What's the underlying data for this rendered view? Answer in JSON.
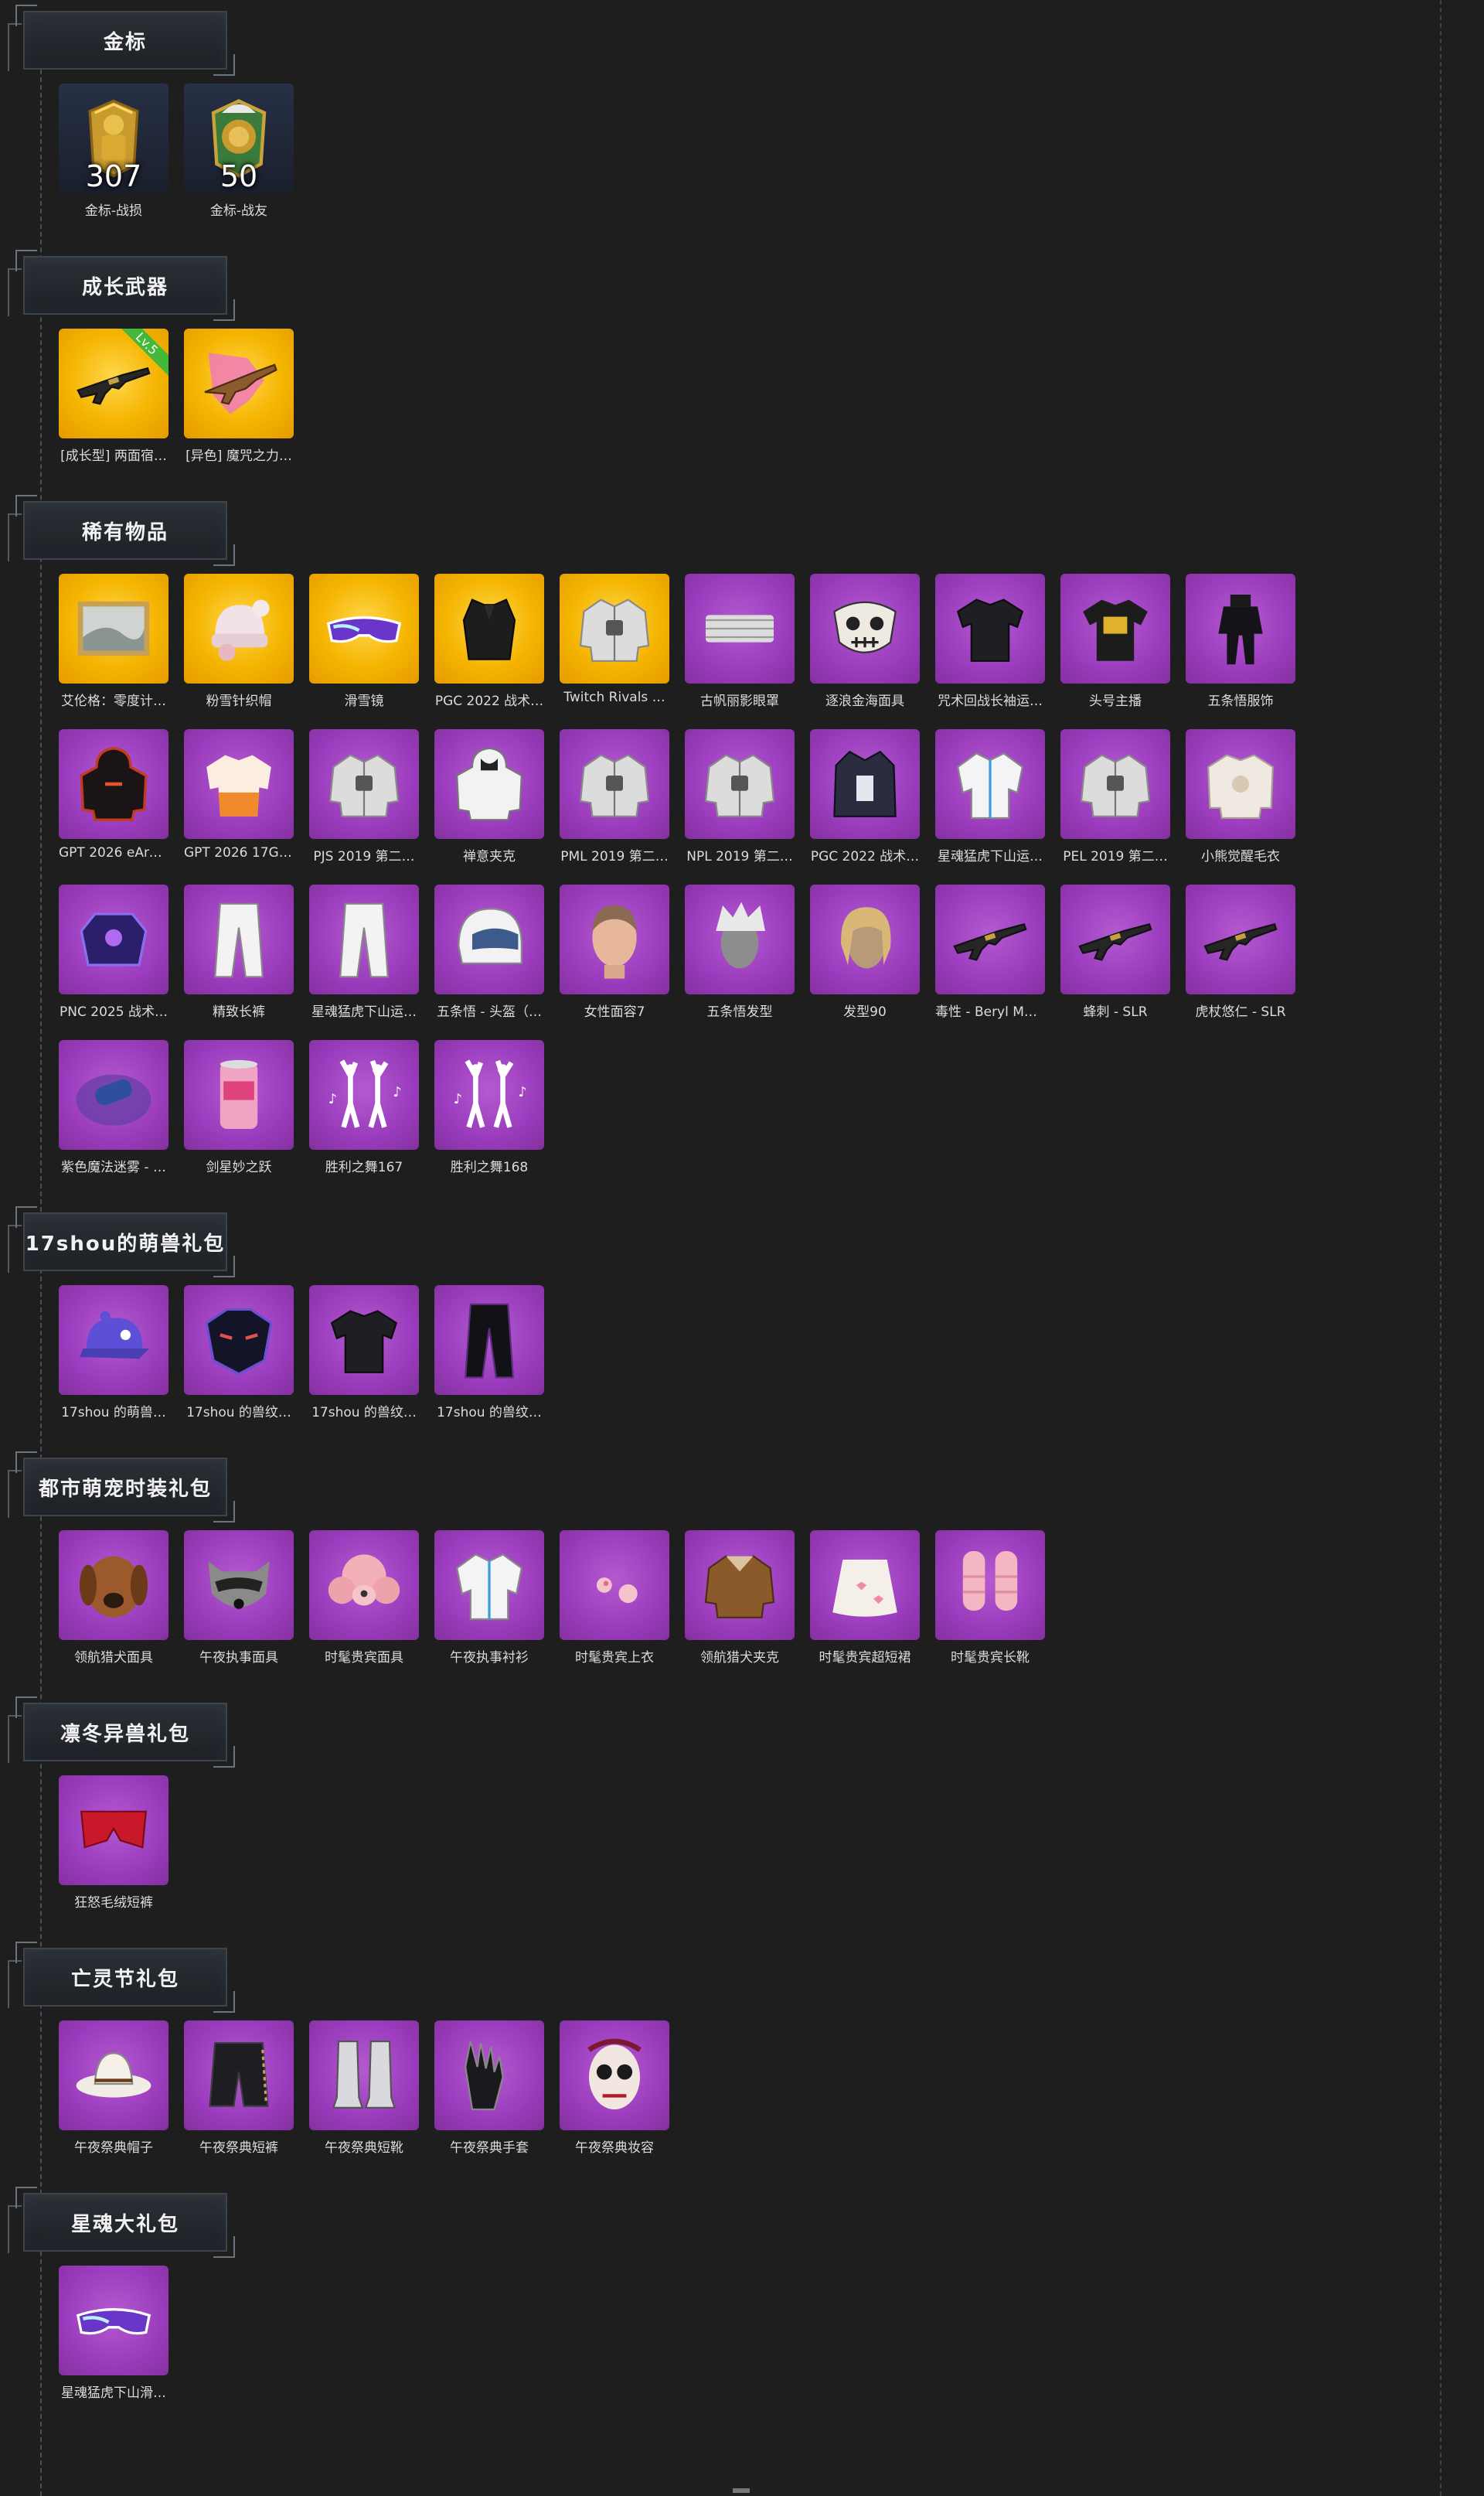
{
  "sections": [
    {
      "title": "金标",
      "items": [
        {
          "label": "金标-战损",
          "bg": "dark",
          "icon": "soldier-medal-icon",
          "number": "307"
        },
        {
          "label": "金标-战友",
          "bg": "dark",
          "icon": "lion-medal-icon",
          "number": "50"
        }
      ]
    },
    {
      "title": "成长武器",
      "items": [
        {
          "label": "[成长型] 两面宿…",
          "bg": "gold",
          "icon": "rifle-icon",
          "ribbon": "Lv.5"
        },
        {
          "label": "[异色] 魔咒之力…",
          "bg": "gold",
          "icon": "rifle-pink-icon"
        }
      ]
    },
    {
      "title": "稀有物品",
      "items": [
        {
          "label": "艾伦格：零度计…",
          "bg": "gold",
          "icon": "painting-icon"
        },
        {
          "label": "粉雪针织帽",
          "bg": "gold",
          "icon": "beanie-icon"
        },
        {
          "label": "滑雪镜",
          "bg": "gold",
          "icon": "goggles-icon"
        },
        {
          "label": "PGC 2022 战术…",
          "bg": "gold",
          "icon": "vest-icon"
        },
        {
          "label": "Twitch Rivals …",
          "bg": "gold",
          "icon": "jacket-icon"
        },
        {
          "label": "古帆丽影眼罩",
          "bg": "purple",
          "icon": "mask-band-icon"
        },
        {
          "label": "逐浪金海面具",
          "bg": "purple",
          "icon": "skull-mask-icon"
        },
        {
          "label": "咒术回战长袖运…",
          "bg": "purple",
          "icon": "shirt-dark-icon"
        },
        {
          "label": "头号主播",
          "bg": "purple",
          "icon": "tshirt-icon"
        },
        {
          "label": "五条悟服饰",
          "bg": "purple",
          "icon": "suit-icon"
        },
        {
          "label": "GPT 2026 eAre…",
          "bg": "purple",
          "icon": "hoodie-icon"
        },
        {
          "label": "GPT 2026 17Ga…",
          "bg": "purple",
          "icon": "shirt-orange-icon"
        },
        {
          "label": "PJS 2019 第二…",
          "bg": "purple",
          "icon": "jacket-icon"
        },
        {
          "label": "禅意夹克",
          "bg": "purple",
          "icon": "hoodie-white-icon"
        },
        {
          "label": "PML 2019 第二…",
          "bg": "purple",
          "icon": "jacket-icon"
        },
        {
          "label": "NPL 2019 第二…",
          "bg": "purple",
          "icon": "jacket-icon"
        },
        {
          "label": "PGC 2022 战术…",
          "bg": "purple",
          "icon": "coat-icon"
        },
        {
          "label": "星魂猛虎下山运…",
          "bg": "purple",
          "icon": "shirt-white-icon"
        },
        {
          "label": "PEL 2019 第二…",
          "bg": "purple",
          "icon": "jacket-icon"
        },
        {
          "label": "小熊觉醒毛衣",
          "bg": "purple",
          "icon": "sweater-icon"
        },
        {
          "label": "PNC 2025 战术…",
          "bg": "purple",
          "icon": "armor-icon"
        },
        {
          "label": "精致长裤",
          "bg": "purple",
          "icon": "pants-icon"
        },
        {
          "label": "星魂猛虎下山运…",
          "bg": "purple",
          "icon": "pants-icon"
        },
        {
          "label": "五条悟 - 头盔（…",
          "bg": "purple",
          "icon": "helmet-icon"
        },
        {
          "label": "女性面容7",
          "bg": "purple",
          "icon": "face-icon"
        },
        {
          "label": "五条悟发型",
          "bg": "purple",
          "icon": "hair-icon"
        },
        {
          "label": "发型90",
          "bg": "purple",
          "icon": "hair-blonde-icon"
        },
        {
          "label": "毒性 - Beryl M7…",
          "bg": "purple",
          "icon": "rifle-icon"
        },
        {
          "label": "蜂刺 - SLR",
          "bg": "purple",
          "icon": "rifle-icon"
        },
        {
          "label": "虎杖悠仁 - SLR",
          "bg": "purple",
          "icon": "rifle-icon"
        },
        {
          "label": "紫色魔法迷雾 - …",
          "bg": "purple",
          "icon": "smoke-icon"
        },
        {
          "label": "剑星妙之跃",
          "bg": "purple",
          "icon": "can-icon"
        },
        {
          "label": "胜利之舞167",
          "bg": "purple",
          "icon": "dance-icon"
        },
        {
          "label": "胜利之舞168",
          "bg": "purple",
          "icon": "dance-icon"
        }
      ]
    },
    {
      "title": "17shou的萌兽礼包",
      "items": [
        {
          "label": "17shou 的萌兽…",
          "bg": "purple",
          "icon": "cap-icon"
        },
        {
          "label": "17shou 的兽纹…",
          "bg": "purple",
          "icon": "beast-mask-icon"
        },
        {
          "label": "17shou 的兽纹…",
          "bg": "purple",
          "icon": "shirt-dark-icon"
        },
        {
          "label": "17shou 的兽纹…",
          "bg": "purple",
          "icon": "pants-dark-icon"
        }
      ]
    },
    {
      "title": "都市萌宠时装礼包",
      "items": [
        {
          "label": "领航猎犬面具",
          "bg": "purple",
          "icon": "dog-mask-icon"
        },
        {
          "label": "午夜执事面具",
          "bg": "purple",
          "icon": "raccoon-mask-icon"
        },
        {
          "label": "时髦贵宾面具",
          "bg": "purple",
          "icon": "poodle-mask-icon"
        },
        {
          "label": "午夜执事衬衫",
          "bg": "purple",
          "icon": "shirt-white-icon"
        },
        {
          "label": "时髦贵宾上衣",
          "bg": "purple",
          "icon": "pom-icon"
        },
        {
          "label": "领航猎犬夹克",
          "bg": "purple",
          "icon": "jacket-brown-icon"
        },
        {
          "label": "时髦贵宾超短裙",
          "bg": "purple",
          "icon": "skirt-icon"
        },
        {
          "label": "时髦贵宾长靴",
          "bg": "purple",
          "icon": "boots-pink-icon"
        }
      ]
    },
    {
      "title": "凛冬异兽礼包",
      "items": [
        {
          "label": "狂怒毛绒短裤",
          "bg": "purple",
          "icon": "shorts-red-icon"
        }
      ]
    },
    {
      "title": "亡灵节礼包",
      "items": [
        {
          "label": "午夜祭典帽子",
          "bg": "purple",
          "icon": "hat-icon"
        },
        {
          "label": "午夜祭典短裤",
          "bg": "purple",
          "icon": "shorts-dark-icon"
        },
        {
          "label": "午夜祭典短靴",
          "bg": "purple",
          "icon": "boots-icon"
        },
        {
          "label": "午夜祭典手套",
          "bg": "purple",
          "icon": "gloves-icon"
        },
        {
          "label": "午夜祭典妆容",
          "bg": "purple",
          "icon": "skull-face-icon"
        }
      ]
    },
    {
      "title": "星魂大礼包",
      "items": [
        {
          "label": "星魂猛虎下山滑…",
          "bg": "purple",
          "icon": "goggles-icon"
        }
      ]
    }
  ]
}
